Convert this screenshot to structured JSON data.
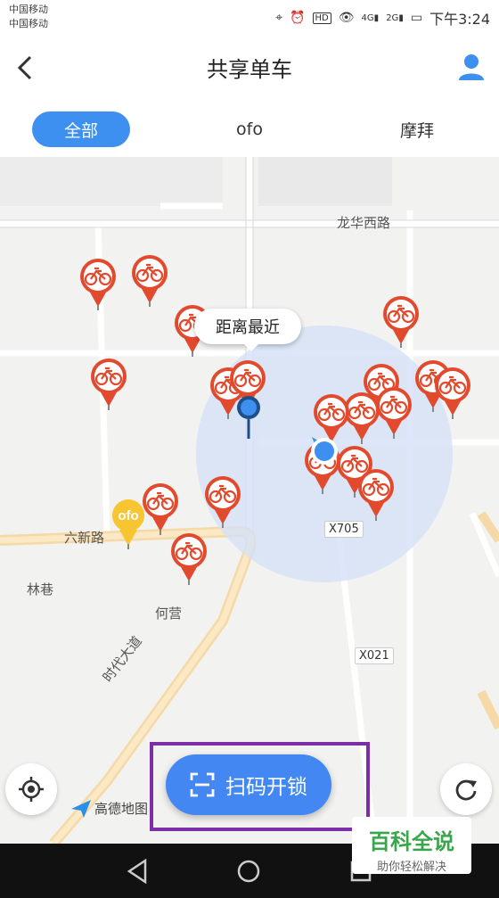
{
  "status_bar": {
    "carrier_1": "中国移动",
    "carrier_2": "中国移动",
    "icons": [
      "location-icon",
      "alarm-icon",
      "hd-icon",
      "eye-icon",
      "signal-4g-icon",
      "signal-2g-icon",
      "battery-icon"
    ],
    "hd": "HD",
    "net1": "4G",
    "net2": "2G",
    "time": "下午3:24"
  },
  "header": {
    "title": "共享单车"
  },
  "tabs": [
    {
      "label": "全部",
      "active": true
    },
    {
      "label": "ofo",
      "active": false
    },
    {
      "label": "摩拜",
      "active": false
    }
  ],
  "map": {
    "labels": {
      "road_longhua": "龙华西路",
      "road_liuxin": "六新路",
      "linxiang": "林巷",
      "heying": "何营",
      "road_shidai": "时代大道"
    },
    "badges": {
      "x705": "X705",
      "x021": "X021"
    },
    "tooltip": "距离最近",
    "amap_logo": "高德地图",
    "colors": {
      "mobike": "#e24a2e",
      "ofo": "#f7c531",
      "user_circle": "#d5e1f8",
      "user_dot": "#3d8ff0"
    }
  },
  "actions": {
    "scan_label": "扫码开锁"
  },
  "watermark": {
    "title": "百科全说",
    "subtitle": "助你轻松解决"
  }
}
